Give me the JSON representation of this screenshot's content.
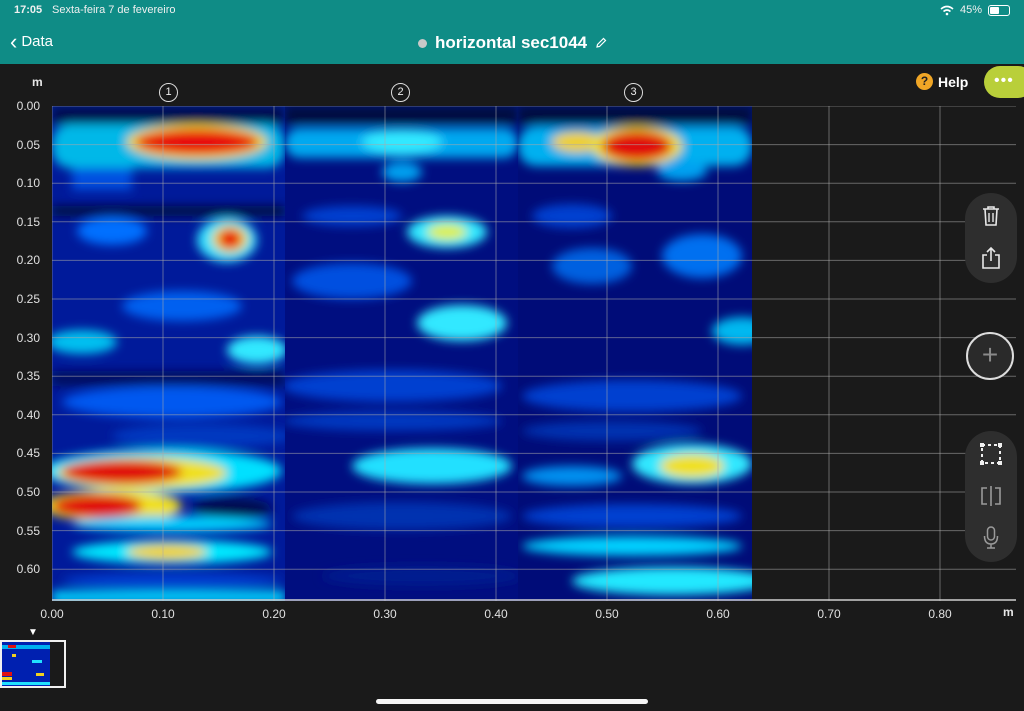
{
  "status": {
    "time": "17:05",
    "date": "Sexta-feira 7 de fevereiro",
    "battery": "45%",
    "battery_level": 0.45
  },
  "nav": {
    "back_label": "Data",
    "title": "horizontal sec1044"
  },
  "axis": {
    "unit_y": "m",
    "unit_x": "m",
    "y_ticks": [
      "0.00",
      "0.05",
      "0.10",
      "0.15",
      "0.20",
      "0.25",
      "0.30",
      "0.35",
      "0.40",
      "0.45",
      "0.50",
      "0.55",
      "0.60"
    ],
    "x_ticks": [
      "0.00",
      "0.10",
      "0.20",
      "0.30",
      "0.40",
      "0.50",
      "0.60",
      "0.70",
      "0.80"
    ]
  },
  "sections": [
    "1",
    "2",
    "3"
  ],
  "help_label": "Help",
  "more_label": "•••",
  "icons": {
    "delete": "trash-icon",
    "share": "share-icon",
    "add": "plus-icon",
    "select": "selection-icon",
    "split": "split-icon",
    "mic": "microphone-icon"
  },
  "colors": {
    "header": "#0f8c86",
    "accent": "#b9cf3a",
    "help": "#f0a626"
  },
  "scan_extent_m": {
    "x_max": 0.63,
    "y_max": 0.645
  }
}
